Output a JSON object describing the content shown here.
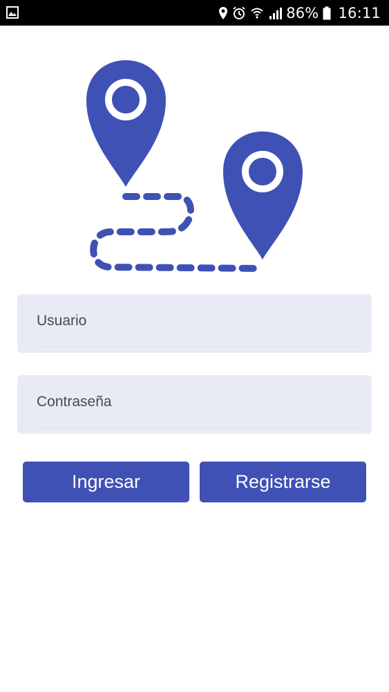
{
  "status_bar": {
    "battery_percent": "86%",
    "time": "16:11",
    "icons": [
      "image-icon",
      "location-icon",
      "alarm-icon",
      "wifi-icon",
      "signal-icon",
      "battery-icon"
    ]
  },
  "hero": {
    "icon": "route-map-icon",
    "color": "#3f51b5"
  },
  "form": {
    "username": {
      "value": "",
      "placeholder": "Usuario"
    },
    "password": {
      "value": "",
      "placeholder": "Contraseña"
    }
  },
  "actions": {
    "login_label": "Ingresar",
    "register_label": "Registrarse"
  },
  "theme": {
    "primary": "#3f51b5",
    "field_bg": "#e8eaf6"
  }
}
